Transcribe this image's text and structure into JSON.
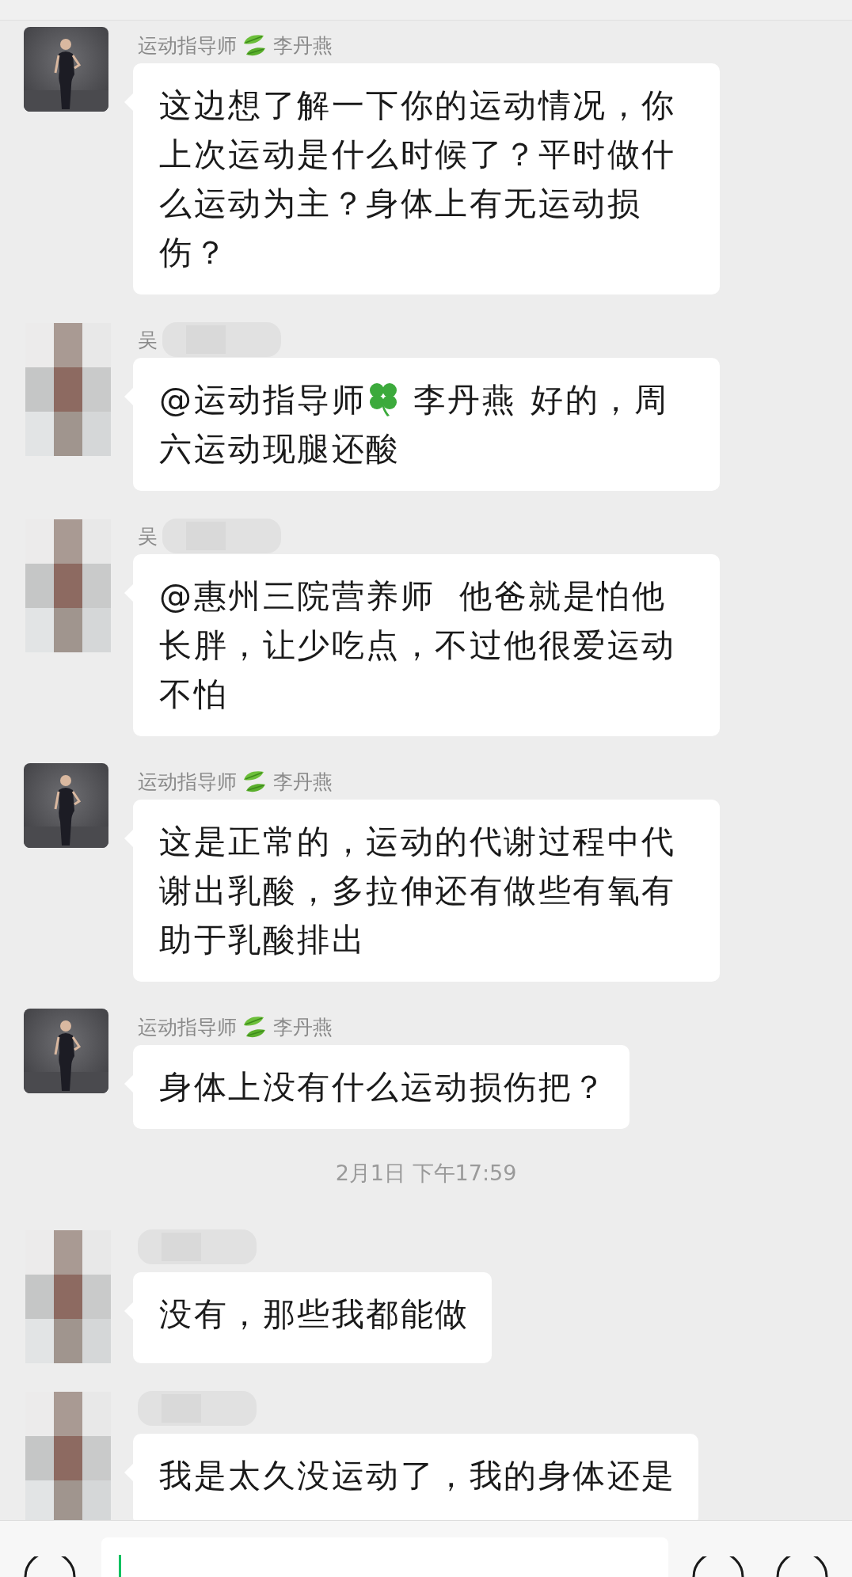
{
  "messages": [
    {
      "kind": "message",
      "sender": {
        "role": "运动指导师",
        "badge": {
          "kind": "leaf"
        },
        "name": "李丹燕"
      },
      "text": "这边想了解一下你的运动情况，你上次运动是什么时候了？平时做什么运动为主？身体上有无运动损伤？"
    },
    {
      "kind": "message",
      "avatar": {
        "kind": "mosaic"
      },
      "sender": {
        "name": "吴"
      },
      "mention": {
        "role": "@运动指导师",
        "badge": {
          "kind": "clover"
        },
        "name": "李丹燕"
      },
      "text": "好的，周六运动现腿还酸"
    },
    {
      "kind": "message",
      "avatar": {
        "kind": "mosaic"
      },
      "sender": {
        "name": "吴"
      },
      "text": "@惠州三院营养师  他爸就是怕他长胖，让少吃点，不过他很爱运动不怕"
    },
    {
      "kind": "message",
      "sender": {
        "role": "运动指导师",
        "badge": {
          "kind": "leaf"
        },
        "name": "李丹燕"
      },
      "text": "这是正常的，运动的代谢过程中代谢出乳酸，多拉伸还有做些有氧有助于乳酸排出"
    },
    {
      "kind": "message",
      "sender": {
        "role": "运动指导师",
        "badge": {
          "kind": "leaf"
        },
        "name": "李丹燕"
      },
      "text": "身体上没有什么运动损伤把？"
    },
    {
      "kind": "time",
      "text": "2月1日 下午17:59"
    },
    {
      "kind": "message",
      "avatar": {
        "kind": "mosaic"
      },
      "text": "没有，那些我都能做"
    },
    {
      "kind": "message",
      "avatar": {
        "kind": "mosaic"
      },
      "text": "我是太久没运动了，我的身体还是"
    }
  ]
}
